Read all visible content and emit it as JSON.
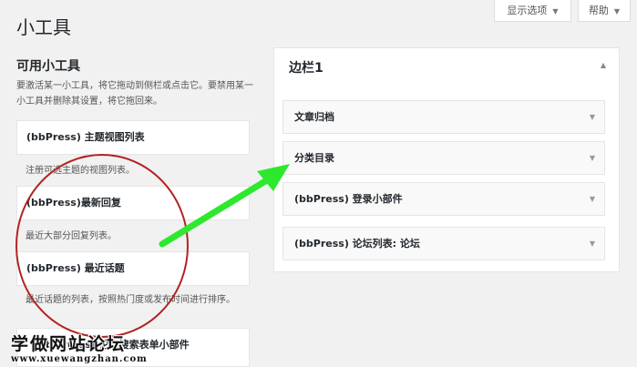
{
  "page_title": "小工具",
  "screen_options": {
    "options_label": "显示选项",
    "help_label": "帮助"
  },
  "available": {
    "title": "可用小工具",
    "description": "要激活某一小工具，将它拖动到侧栏或点击它。要禁用某一小工具并删除其设置，将它拖回来。",
    "widgets": [
      {
        "name": "(bbPress) 主题视图列表",
        "description": "注册可选主题的视图列表。"
      },
      {
        "name": "(bbPress)最新回复",
        "description": "最近大部分回复列表。"
      },
      {
        "name": "(bbPress) 最近话题",
        "description": "最近话题的列表，按照热门度或发布时间进行排序。"
      },
      {
        "name": "(bbPress) 论坛搜索表单小部件",
        "description": ""
      }
    ]
  },
  "sidebar": {
    "title": "边栏1",
    "widgets": [
      "文章归档",
      "分类目录",
      "(bbPress) 登录小部件",
      "(bbPress) 论坛列表: 论坛"
    ]
  },
  "annotation": {
    "circle_color": "#b22222",
    "arrow_color": "#2ee82e"
  },
  "watermark": {
    "title": "学做网站论坛",
    "url": "www.xuewangzhan.com"
  }
}
